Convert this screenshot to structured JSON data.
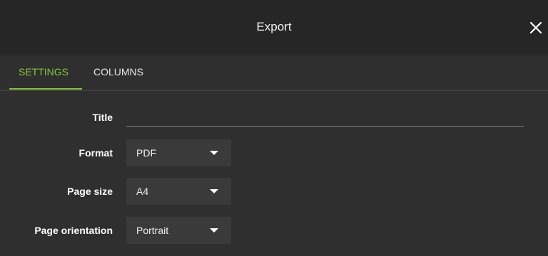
{
  "dialog": {
    "title": "Export",
    "close_icon": "close-icon"
  },
  "tabs": [
    {
      "label": "SETTINGS",
      "active": true
    },
    {
      "label": "COLUMNS",
      "active": false
    }
  ],
  "form": {
    "title": {
      "label": "Title",
      "value": "",
      "placeholder": ""
    },
    "format": {
      "label": "Format",
      "value": "PDF"
    },
    "page_size": {
      "label": "Page size",
      "value": "A4"
    },
    "page_orientation": {
      "label": "Page orientation",
      "value": "Portrait"
    }
  },
  "colors": {
    "background": "#2f2f2f",
    "titlebar": "#262626",
    "accent": "#86c43a",
    "select_bg": "#3a3a3a"
  }
}
